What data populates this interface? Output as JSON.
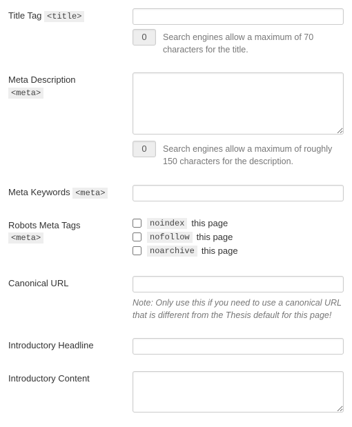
{
  "title_tag": {
    "label": "Title Tag",
    "tag": "<title>",
    "value": "",
    "counter": "0",
    "hint": "Search engines allow a maximum of 70 characters for the title."
  },
  "meta_description": {
    "label": "Meta Description",
    "tag": "<meta>",
    "value": "",
    "counter": "0",
    "hint": "Search engines allow a maximum of roughly 150 characters for the description."
  },
  "meta_keywords": {
    "label": "Meta Keywords",
    "tag": "<meta>",
    "value": ""
  },
  "robots": {
    "label": "Robots Meta Tags",
    "tag": "<meta>",
    "options": [
      {
        "code": "noindex",
        "after": " this page",
        "checked": false
      },
      {
        "code": "nofollow",
        "after": " this page",
        "checked": false
      },
      {
        "code": "noarchive",
        "after": " this page",
        "checked": false
      }
    ]
  },
  "canonical": {
    "label": "Canonical URL",
    "value": "",
    "note": "Note: Only use this if you need to use a canonical URL that is different from the Thesis default for this page!"
  },
  "intro_headline": {
    "label": "Introductory Headline",
    "value": ""
  },
  "intro_content": {
    "label": "Introductory Content",
    "value": ""
  }
}
